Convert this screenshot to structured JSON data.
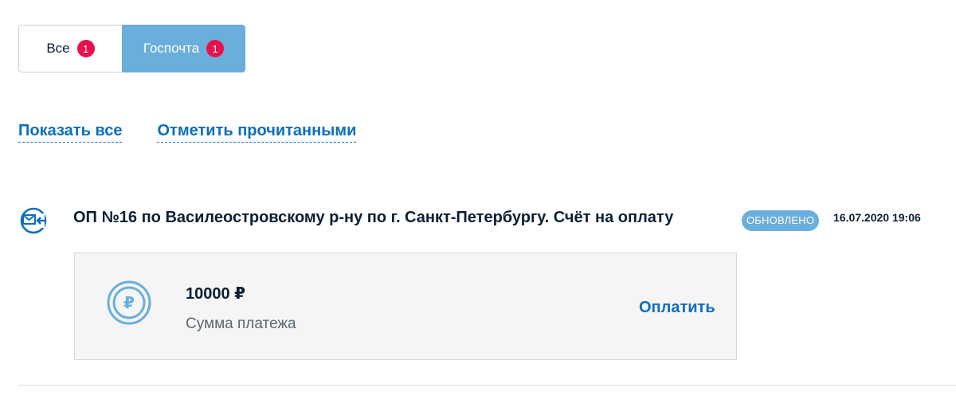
{
  "tabs": [
    {
      "label": "Все",
      "count": "1",
      "active": false
    },
    {
      "label": "Госпочта",
      "count": "1",
      "active": true
    }
  ],
  "links": {
    "show_all": "Показать все",
    "mark_read": "Отметить прочитанными"
  },
  "notification": {
    "icon": "mail-incoming-icon",
    "title": "ОП №16 по Василеостровскому р-ну по г. Санкт-Петербургу. Счёт на оплату",
    "status": "ОБНОВЛЕНО",
    "datetime": "16.07.2020 19:06"
  },
  "payment": {
    "icon": "ruble-coin-icon",
    "amount": "10000 ₽",
    "label": "Сумма платежа",
    "pay_button": "Оплатить"
  },
  "colors": {
    "accent": "#6aaedb",
    "link": "#0d6ebd",
    "badge": "#e8114b"
  }
}
